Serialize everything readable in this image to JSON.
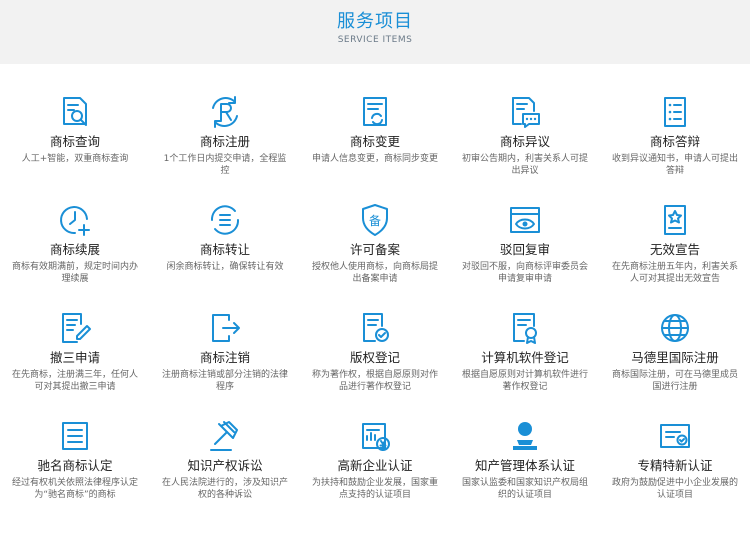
{
  "header": {
    "title": "服务项目",
    "subtitle": "SERVICE ITEMS"
  },
  "colors": {
    "accent": "#1a8fd6",
    "header_bg": "#f2f2f2"
  },
  "items": [
    {
      "name": "商标查询",
      "desc": "人工+智能，双重商标查询",
      "icon": "document-search-icon"
    },
    {
      "name": "商标注册",
      "desc": "1个工作日内提交申请，全程监控",
      "icon": "registered-r-icon"
    },
    {
      "name": "商标变更",
      "desc": "申请人信息变更，商标同步变更",
      "icon": "document-refresh-icon"
    },
    {
      "name": "商标异议",
      "desc": "初审公告期内，利害关系人可提出异议",
      "icon": "document-comment-icon"
    },
    {
      "name": "商标答辩",
      "desc": "收到异议通知书，申请人可提出答辩",
      "icon": "document-list-icon"
    },
    {
      "name": "商标续展",
      "desc": "商标有效期满前，规定时间内办理续展",
      "icon": "clock-plus-icon"
    },
    {
      "name": "商标转让",
      "desc": "闲余商标转让，确保转让有效",
      "icon": "transfer-list-icon"
    },
    {
      "name": "许可备案",
      "desc": "授权他人使用商标，向商标局提出备案申请",
      "icon": "shield-bei-icon"
    },
    {
      "name": "驳回复审",
      "desc": "对驳回不服，向商标评审委员会申请复审申请",
      "icon": "browser-eye-icon"
    },
    {
      "name": "无效宣告",
      "desc": "在先商标注册五年内，利害关系人可对其提出无效宣告",
      "icon": "document-star-icon"
    },
    {
      "name": "撤三申请",
      "desc": "在先商标，注册满三年，任何人可对其提出撤三申请",
      "icon": "document-pen-icon"
    },
    {
      "name": "商标注销",
      "desc": "注册商标注销或部分注销的法律程序",
      "icon": "exit-arrow-icon"
    },
    {
      "name": "版权登记",
      "desc": "称为著作权，根据自愿原则对作品进行著作权登记",
      "icon": "document-check-icon"
    },
    {
      "name": "计算机软件登记",
      "desc": "根据自愿原则对计算机软件进行著作权登记",
      "icon": "document-badge-icon"
    },
    {
      "name": "马德里国际注册",
      "desc": "商标国际注册，可在马德里成员国进行注册",
      "icon": "globe-icon"
    },
    {
      "name": "驰名商标认定",
      "desc": "经过有权机关依照法律程序认定为“驰名商标”的商标",
      "icon": "folder-list-icon"
    },
    {
      "name": "知识产权诉讼",
      "desc": "在人民法院进行的，涉及知识产权的各种诉讼",
      "icon": "gavel-icon"
    },
    {
      "name": "高新企业认证",
      "desc": "为扶持和鼓励企业发展，国家重点支持的认证项目",
      "icon": "chart-money-icon"
    },
    {
      "name": "知产管理体系认证",
      "desc": "国家认监委和国家知识产权局组织的认证项目",
      "icon": "user-seal-icon"
    },
    {
      "name": "专精特新认证",
      "desc": "政府为鼓励促进中小企业发展的认证项目",
      "icon": "card-check-icon"
    }
  ]
}
